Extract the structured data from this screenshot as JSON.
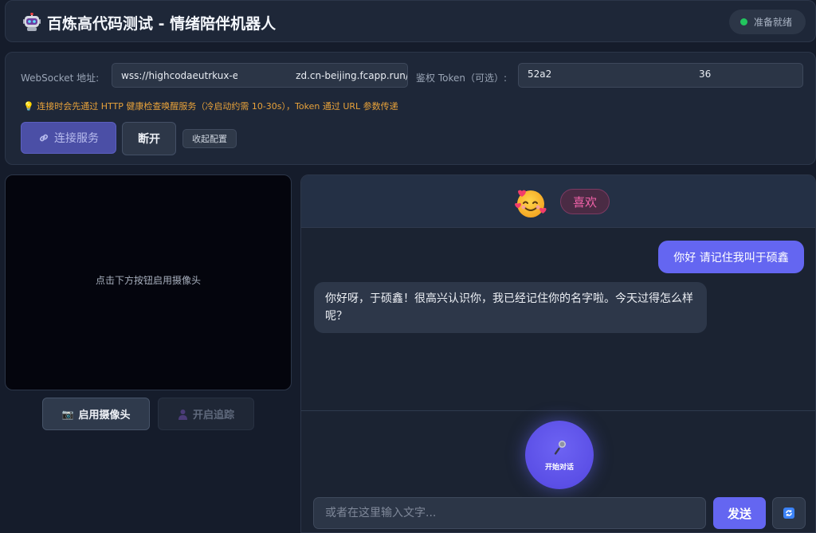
{
  "header": {
    "title": "百炼高代码测试 - 情绪陪伴机器人",
    "status_text": "准备就绪"
  },
  "config": {
    "ws_label": "WebSocket 地址:",
    "ws_value": "wss://highcodaeutrkux-e　　　　　　zd.cn-beijing.fcapp.run/ws",
    "token_label": "鉴权 Token（可选）:",
    "token_value": "52a2",
    "token_tail": "36",
    "hint": "连接时会先通过 HTTP 健康检查唤醒服务（冷启动约需 10-30s），Token 通过 URL 参数传递",
    "connect_label": "连接服务",
    "disconnect_label": "断开",
    "collapse_label": "收起配置"
  },
  "camera": {
    "placeholder": "点击下方按钮启用摄像头",
    "enable_label": "启用摄像头",
    "track_label": "开启追踪"
  },
  "chat": {
    "emotion": "喜欢",
    "messages": [
      {
        "role": "user",
        "text": "你好 请记住我叫于硕鑫"
      },
      {
        "role": "bot",
        "text": "你好呀，于硕鑫！很高兴认识你，我已经记住你的名字啦。今天过得怎么样呢？"
      }
    ],
    "mic_label": "开始对话",
    "input_placeholder": "或者在这里输入文字...",
    "send_label": "发送"
  },
  "colors": {
    "accent": "#6466f1",
    "status_ok": "#22c55e",
    "hint": "#e8a23a",
    "emotion": "#f062a8"
  },
  "icons": [
    "robot-icon",
    "status-dot",
    "lightbulb-icon",
    "link-icon",
    "camera-icon",
    "person-icon",
    "smiling-hearts-emoji",
    "microphone-icon",
    "refresh-icon"
  ]
}
